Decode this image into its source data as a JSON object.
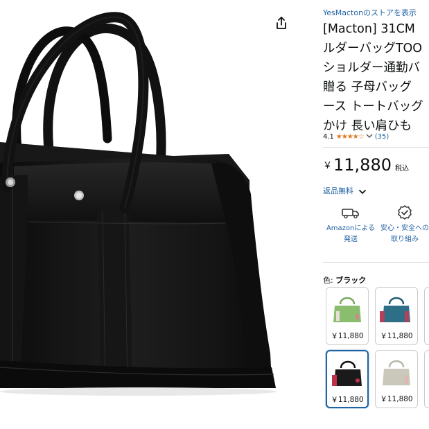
{
  "product": {
    "store_link": "YesMactonのストアを表示",
    "title_lines": [
      "[Macton] 31CM",
      "ルダーバッグTOO",
      "ショルダー通勤バ",
      "贈る 子母バッグ",
      "ース トートバッグ",
      "かけ 長い肩ひも"
    ],
    "rating_value": "4.1",
    "stars_display": "★★★★☆",
    "rating_count": "(35)",
    "price_symbol": "￥",
    "price_amount": "11,880",
    "price_tax": "税込",
    "shipping": "返品無料"
  },
  "features": [
    {
      "line1": "Amazonによる",
      "line2": "発送",
      "icon": "delivery-truck-icon"
    },
    {
      "line1": "安心・安全への",
      "line2": "取り組み",
      "icon": "safety-badge-icon"
    }
  ],
  "color": {
    "label": "色:",
    "selected": "ブラック"
  },
  "swatches": [
    {
      "price": "￥11,880",
      "bag_color": "#8bbd6e",
      "accent": "#c98a8a"
    },
    {
      "price": "￥11,880",
      "bag_color": "#2c6f86",
      "accent": "#b2405a"
    },
    {
      "price": "￥11,880",
      "bag_color": "#1a1a1a",
      "accent": "#c0304a"
    },
    {
      "price": "￥11,880",
      "bag_color": "#c9c8bb",
      "accent": "#e0b8b0"
    }
  ],
  "colors": {
    "link": "#2162a1",
    "star": "#de7921",
    "bag": "#151515",
    "selected_border": "#2162a1"
  },
  "icons": {
    "share": "share-icon",
    "chevron": "chevron-down-icon"
  }
}
